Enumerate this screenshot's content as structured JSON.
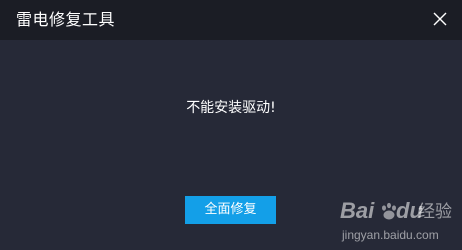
{
  "dialog": {
    "title": "雷电修复工具",
    "message": "不能安装驱动!",
    "repair_button_label": "全面修复",
    "close_icon": "close-icon"
  },
  "watermark": {
    "brand_left": "Bai",
    "brand_right": "du",
    "brand_suffix": "经验",
    "url": "jingyan.baidu.com"
  },
  "colors": {
    "titlebar": "#1b1d25",
    "body": "#262937",
    "button": "#139fe8",
    "text": "#ffffff"
  }
}
